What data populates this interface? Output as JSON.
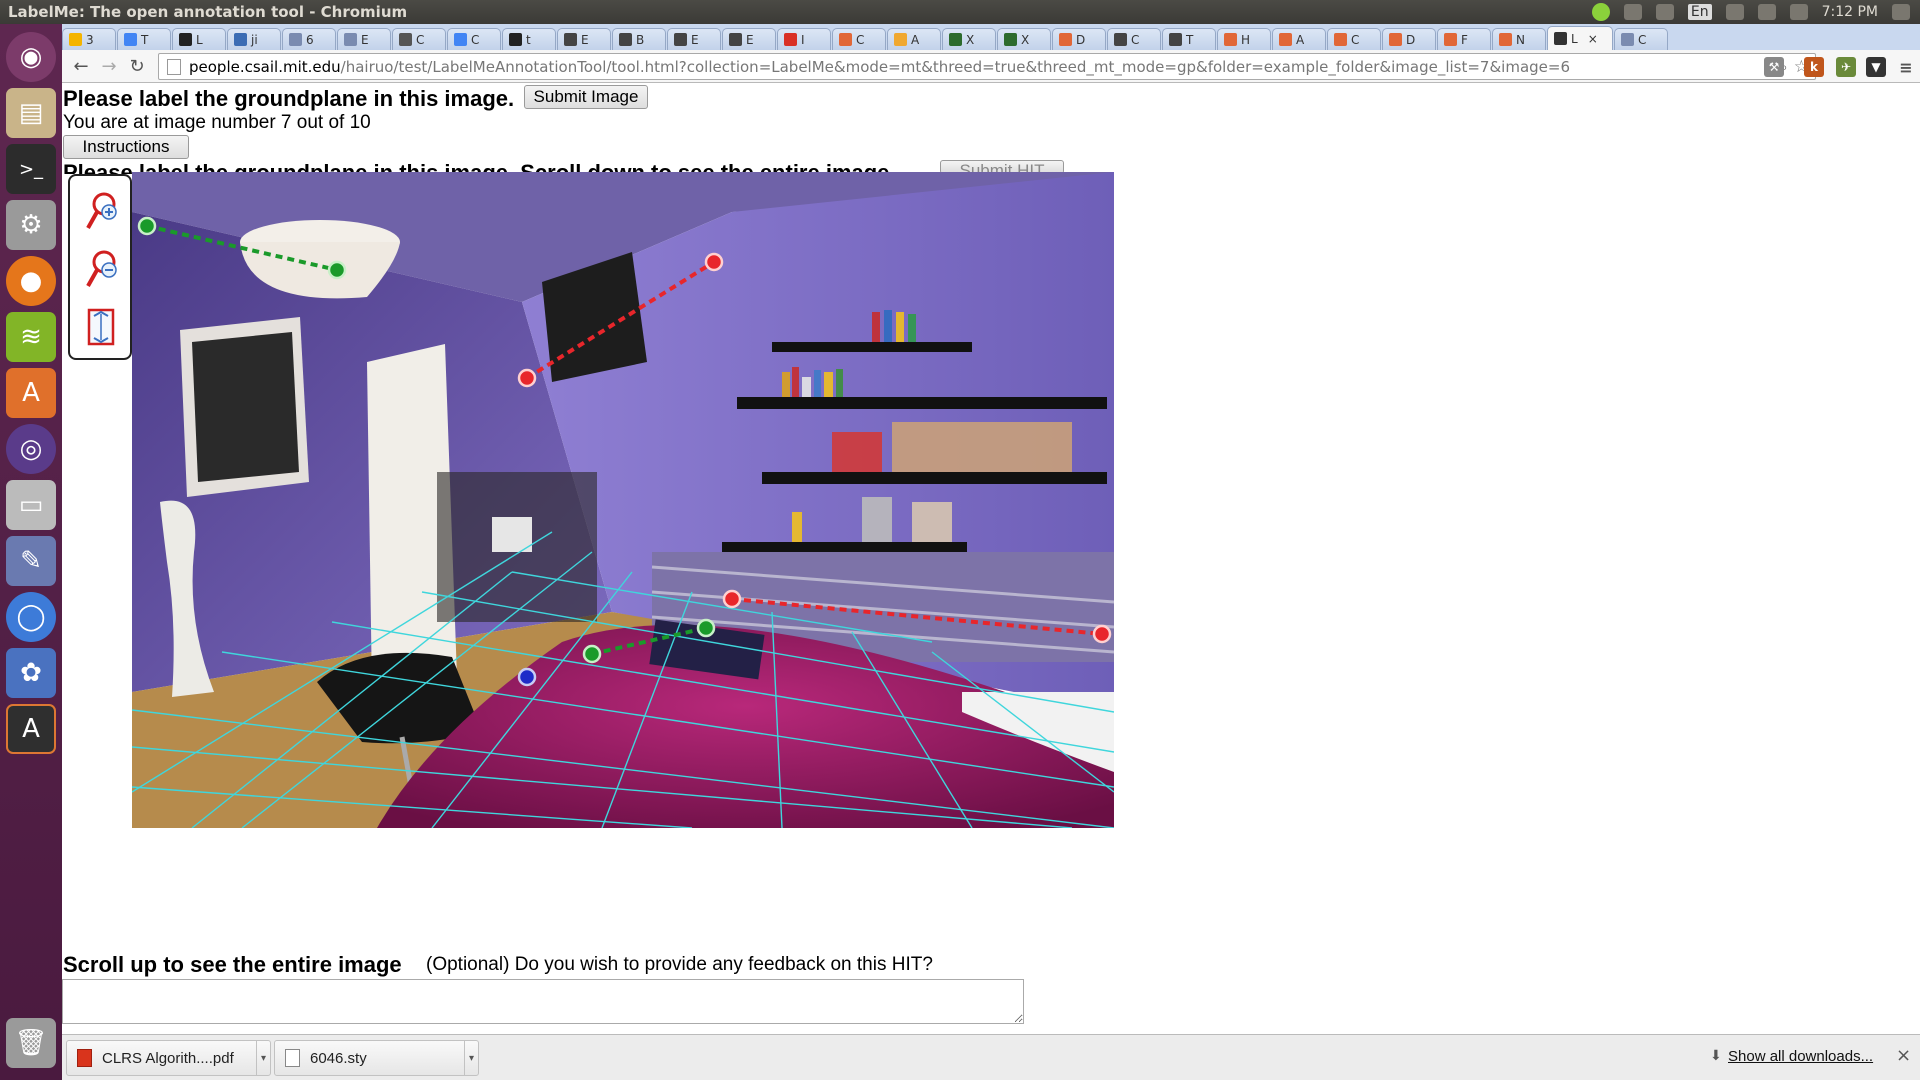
{
  "window": {
    "title": "LabelMe: The open annotation tool - Chromium"
  },
  "panel": {
    "keyboard": "En",
    "time": "7:12 PM"
  },
  "tabs": [
    {
      "label": "3",
      "icon": "drive-icon",
      "color": "#f4b400"
    },
    {
      "label": "T",
      "icon": "docs-icon",
      "color": "#4285f4"
    },
    {
      "label": "L",
      "icon": "github-icon",
      "color": "#222222"
    },
    {
      "label": "ji",
      "icon": "site-icon",
      "color": "#3b6cb4"
    },
    {
      "label": "6",
      "icon": "site-icon",
      "color": "#7a8bb0"
    },
    {
      "label": "E",
      "icon": "site-icon",
      "color": "#7a8bb0"
    },
    {
      "label": "C",
      "icon": "site-icon",
      "color": "#555555"
    },
    {
      "label": "C",
      "icon": "docs-icon",
      "color": "#4285f4"
    },
    {
      "label": "t",
      "icon": "github-icon",
      "color": "#222222"
    },
    {
      "label": "E",
      "icon": "wiki-icon",
      "color": "#444444"
    },
    {
      "label": "B",
      "icon": "wiki-icon",
      "color": "#444444"
    },
    {
      "label": "E",
      "icon": "wiki-icon",
      "color": "#444444"
    },
    {
      "label": "E",
      "icon": "wiki-icon",
      "color": "#444444"
    },
    {
      "label": "I",
      "icon": "gmail-icon",
      "color": "#d93025"
    },
    {
      "label": "C",
      "icon": "matlab-icon",
      "color": "#e16737"
    },
    {
      "label": "A",
      "icon": "site-icon",
      "color": "#f0a830"
    },
    {
      "label": "X",
      "icon": "w3-icon",
      "color": "#2d6b2d"
    },
    {
      "label": "X",
      "icon": "w3-icon",
      "color": "#2d6b2d"
    },
    {
      "label": "D",
      "icon": "matlab-icon",
      "color": "#e16737"
    },
    {
      "label": "C",
      "icon": "wiki-icon",
      "color": "#444444"
    },
    {
      "label": "T",
      "icon": "wiki-icon",
      "color": "#444444"
    },
    {
      "label": "H",
      "icon": "matlab-icon",
      "color": "#e16737"
    },
    {
      "label": "A",
      "icon": "matlab-icon",
      "color": "#e16737"
    },
    {
      "label": "C",
      "icon": "matlab-icon",
      "color": "#e16737"
    },
    {
      "label": "D",
      "icon": "matlab-icon",
      "color": "#e16737"
    },
    {
      "label": "F",
      "icon": "matlab-icon",
      "color": "#e16737"
    },
    {
      "label": "N",
      "icon": "matlab-icon",
      "color": "#e16737"
    },
    {
      "label": "L",
      "icon": "labelme-icon",
      "color": "#333333",
      "active": true
    },
    {
      "label": "C",
      "icon": "site-icon",
      "color": "#7a8bb0"
    }
  ],
  "toolbar": {
    "url_host": "people.csail.mit.edu",
    "url_path": "/hairuo/test/LabelMeAnnotationTool/tool.html?collection=LabelMe&mode=mt&threed=true&threed_mt_mode=gp&folder=example_folder&image_list=7&image=6"
  },
  "page": {
    "heading": "Please label the groundplane in this image.",
    "submit_image": "Submit Image",
    "progress": "You are at image number 7 out of 10",
    "instructions": "Instructions",
    "subheading": "Please label the groundplane in this image. Scroll down to see the entire image.",
    "submit_hit": "Submit HIT",
    "scroll_up": "Scroll up to see the entire image",
    "feedback_prompt": "(Optional) Do you wish to provide any feedback on this HIT?"
  },
  "annotation_colors": {
    "red": "#e8262b",
    "green": "#1a9a2a",
    "blue": "#1e2bc8",
    "grid": "#3fd6dc"
  },
  "downloads": {
    "items": [
      {
        "name": "CLRS Algorith....pdf",
        "icon": "pdf-icon"
      },
      {
        "name": "6046.sty",
        "icon": "file-icon"
      }
    ],
    "show_all": "Show all downloads...",
    "close": "×"
  }
}
